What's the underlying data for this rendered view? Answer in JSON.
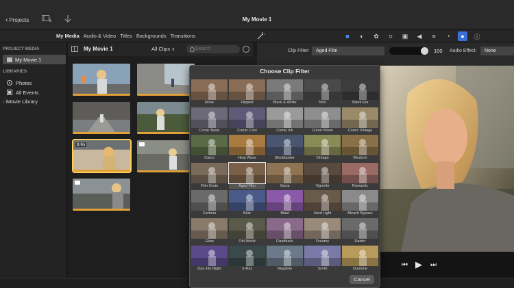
{
  "titlebar": {
    "back_label": "Projects",
    "window_title": "My Movie 1"
  },
  "tabs": [
    {
      "label": "My Media",
      "active": true
    },
    {
      "label": "Audio & Video",
      "active": false
    },
    {
      "label": "Titles",
      "active": false
    },
    {
      "label": "Backgrounds",
      "active": false
    },
    {
      "label": "Transitions",
      "active": false
    }
  ],
  "toolbar_icons": [
    "video-camera-icon",
    "color-balance-icon",
    "color-palette-icon",
    "crop-icon",
    "stabilization-icon",
    "volume-icon",
    "equalizer-icon",
    "speed-icon",
    "clip-filter-icon",
    "info-icon"
  ],
  "sidebar": {
    "project_media_heading": "PROJECT MEDIA",
    "project_item": "My Movie 1",
    "libraries_heading": "LIBRARIES",
    "library_items": [
      {
        "label": "Photos",
        "icon": "photos-icon"
      },
      {
        "label": "All Events",
        "icon": "events-icon"
      }
    ],
    "imovie_library": "iMovie Library"
  },
  "browser": {
    "title": "My Movie 1",
    "clips_filter": "All Clips",
    "search_placeholder": "Search",
    "clips": [
      {
        "duration": "",
        "used": true,
        "selected": false,
        "has_camera": false
      },
      {
        "duration": "",
        "used": true,
        "selected": false,
        "has_camera": false
      },
      {
        "duration": "",
        "used": true,
        "selected": false,
        "has_camera": false
      },
      {
        "duration": "",
        "used": true,
        "selected": false,
        "has_camera": false
      },
      {
        "duration": "8.6s",
        "used": true,
        "selected": true,
        "has_camera": false
      },
      {
        "duration": "",
        "used": true,
        "selected": false,
        "has_camera": true
      },
      {
        "duration": "",
        "used": true,
        "selected": false,
        "has_camera": true
      }
    ]
  },
  "inspector": {
    "clip_filter_label": "Clip Filter:",
    "clip_filter_value": "Aged Film",
    "intensity": "100",
    "audio_effect_label": "Audio Effect:",
    "audio_effect_value": "None"
  },
  "dialog": {
    "title": "Choose Clip Filter",
    "cancel_label": "Cancel",
    "selected": "Aged Film",
    "filters": [
      "None",
      "Flipped",
      "Black & White",
      "Noir",
      "Silent Era",
      "Comic Basic",
      "Comic Cool",
      "Comic Ink",
      "Comic Mono",
      "Comic Vintage",
      "Camo",
      "Heat Wave",
      "Blockbuster",
      "Vintage",
      "Western",
      "Film Grain",
      "Aged Film",
      "Sepia",
      "Vignette",
      "Romantic",
      "Cartoon",
      "Blue",
      "Blast",
      "Hard Light",
      "Bleach Bypass",
      "Glow",
      "Old World",
      "Flashback",
      "Dreamy",
      "Raster",
      "Day into Night",
      "X-Ray",
      "Negative",
      "Sci-Fi",
      "Duotone"
    ],
    "filter_tints": [
      "#8a6d56",
      "#8a6d56",
      "#7a7a7a",
      "#4a4a4a",
      "#3c3c3c",
      "#6c6a78",
      "#5e5a78",
      "#9a9a9a",
      "#8e8e8e",
      "#9a8a6a",
      "#5a6a46",
      "#a87a40",
      "#4a5670",
      "#8a8a56",
      "#8a7046",
      "#7a6a5a",
      "#7a6048",
      "#8e7452",
      "#5a4a3e",
      "#9a6a64",
      "#6a6a6a",
      "#4a5a88",
      "#8a5aa8",
      "#6a5a4a",
      "#8a8a8a",
      "#8a7a6a",
      "#5a5a4a",
      "#8a6a8a",
      "#9a8a7a",
      "#6a6a6a",
      "#5a4a8a",
      "#3a4a4a",
      "#6a7a8a",
      "#7a7aa8",
      "#b89a5a"
    ]
  },
  "player": {
    "prev": "⏮",
    "play": "▶",
    "next": "⏭"
  }
}
